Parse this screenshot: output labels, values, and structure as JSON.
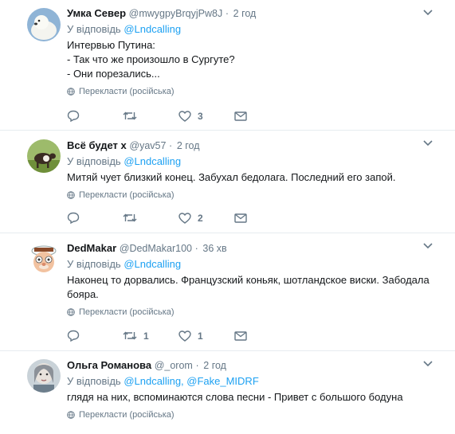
{
  "reply_prefix": "У відповідь",
  "translate_label": "Перекласти (російська)",
  "tweets": [
    {
      "name": "Умка Север",
      "handle": "@mwygpyBrqyjPw8J",
      "dot": "·",
      "time": "2 год",
      "reply_to": "@Lndcalling",
      "lines": [
        "Интервью Путина:",
        "- Так что же произошло в Сургуте?",
        "- Они порезались..."
      ],
      "replies": "",
      "retweets": "",
      "likes": "3"
    },
    {
      "name": "Всё будет х",
      "handle": "@yav57",
      "dot": "·",
      "time": "2 год",
      "reply_to": "@Lndcalling",
      "lines": [
        "Митяй чует близкий конец. Забухал бедолага. Последний его запой."
      ],
      "replies": "",
      "retweets": "",
      "likes": "2"
    },
    {
      "name": "DedMakar",
      "handle": "@DedMakar100",
      "dot": "·",
      "time": "36 хв",
      "reply_to": "@Lndcalling",
      "lines": [
        "Наконец то дорвались. Французский коньяк, шотландское виски. Забодала",
        "бояра."
      ],
      "replies": "",
      "retweets": "1",
      "likes": "1"
    },
    {
      "name": "Ольга Романова",
      "handle": "@_orom",
      "dot": "·",
      "time": "2 год",
      "reply_to": "@Lndcalling, @Fake_MIDRF",
      "lines": [
        "глядя на них, вспоминаются слова песни - Привет с большого бодуна"
      ]
    }
  ]
}
